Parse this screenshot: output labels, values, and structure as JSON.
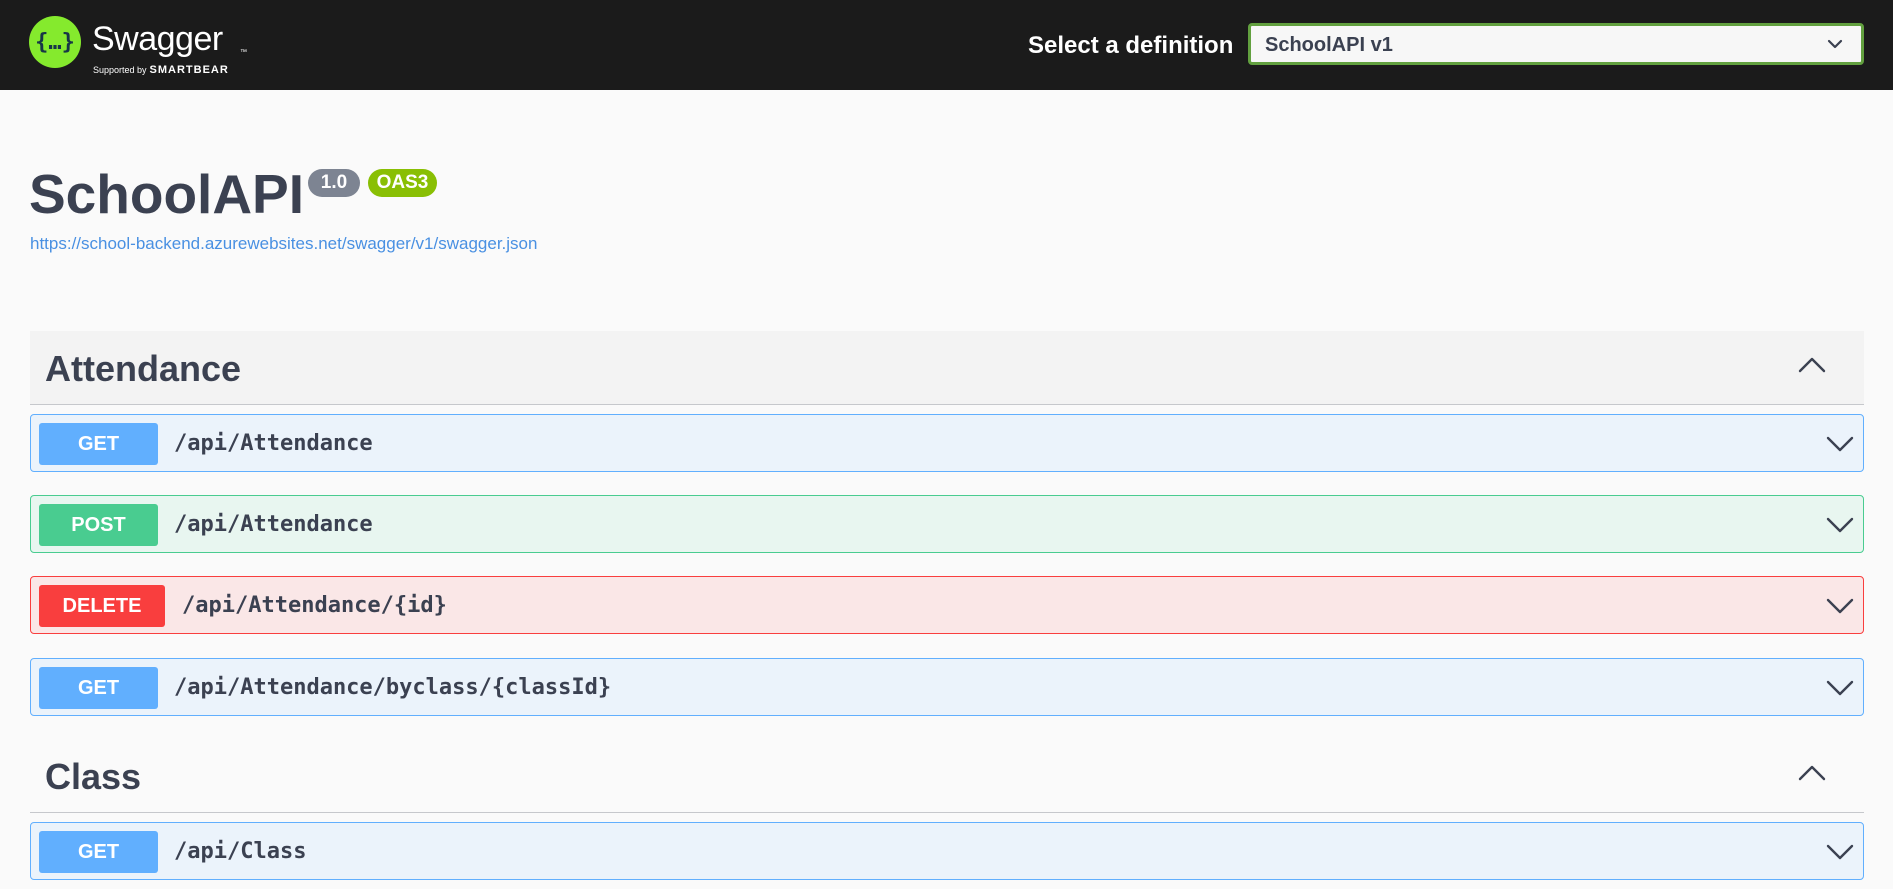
{
  "topbar": {
    "logo_text": "Swagger",
    "logo_tm": "™",
    "logo_supported_by": "Supported by",
    "logo_brand": "SMARTBEAR",
    "definition_label": "Select a definition",
    "definition_value": "SchoolAPI v1"
  },
  "info": {
    "title": "SchoolAPI",
    "version": "1.0",
    "oas": "OAS3",
    "spec_url": "https://school-backend.azurewebsites.net/swagger/v1/swagger.json"
  },
  "tags": [
    {
      "name": "Attendance",
      "operations": [
        {
          "method": "GET",
          "path": "/api/Attendance"
        },
        {
          "method": "POST",
          "path": "/api/Attendance"
        },
        {
          "method": "DELETE",
          "path": "/api/Attendance/{id}"
        },
        {
          "method": "GET",
          "path": "/api/Attendance/byclass/{classId}"
        }
      ]
    },
    {
      "name": "Class",
      "operations": [
        {
          "method": "GET",
          "path": "/api/Class"
        }
      ]
    }
  ],
  "colors": {
    "get": "#61affe",
    "post": "#49cc90",
    "delete": "#f93e3e",
    "brand_green": "#85ea2d",
    "link": "#4990e2"
  },
  "icons": {
    "logo": "swagger-braces-icon",
    "select": "chevron-down-icon",
    "tag_toggle": "chevron-up-icon",
    "operation_toggle": "chevron-down-icon"
  }
}
